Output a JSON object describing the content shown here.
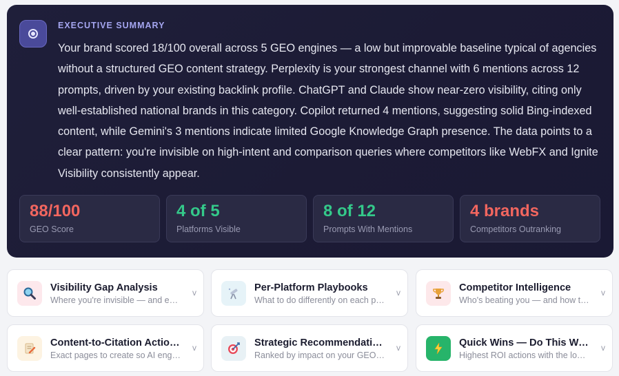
{
  "summary": {
    "eyebrow": "EXECUTIVE SUMMARY",
    "text": "Your brand scored 18/100 overall across 5 GEO engines — a low but improvable baseline typical of agencies without a structured GEO content strategy. Perplexity is your strongest channel with 6 mentions across 12 prompts, driven by your existing backlink profile. ChatGPT and Claude show near-zero visibility, citing only well-established national brands in this category. Copilot returned 4 mentions, suggesting solid Bing-indexed content, while Gemini's 3 mentions indicate limited Google Knowledge Graph presence. The data points to a clear pattern: you're invisible on high-intent and comparison queries where competitors like WebFX and Ignite Visibility consistently appear.",
    "icon": "target-icon"
  },
  "stats": [
    {
      "value": "88/100",
      "label": "GEO Score",
      "color": "#f2665f"
    },
    {
      "value": "4 of 5",
      "label": "Platforms Visible",
      "color": "#34c98a"
    },
    {
      "value": "8 of 12",
      "label": "Prompts With Mentions",
      "color": "#34c98a"
    },
    {
      "value": "4 brands",
      "label": "Competitors Outranking",
      "color": "#f2665f"
    }
  ],
  "cards": [
    {
      "title": "Visibility Gap Analysis",
      "subtitle": "Where you're invisible — and exactly why",
      "icon": "magnifier-icon",
      "chevron": "v"
    },
    {
      "title": "Per-Platform Playbooks",
      "subtitle": "What to do differently on each platform",
      "icon": "telescope-icon",
      "chevron": "v"
    },
    {
      "title": "Competitor Intelligence",
      "subtitle": "Who's beating you — and how they do it",
      "icon": "trophy-icon",
      "chevron": "v"
    },
    {
      "title": "Content-to-Citation Action Plan",
      "subtitle": "Exact pages to create so AI engines cite you",
      "icon": "memo-icon",
      "chevron": "v"
    },
    {
      "title": "Strategic Recommendations",
      "subtitle": "Ranked by impact on your GEO score",
      "icon": "dart-icon",
      "chevron": "v"
    },
    {
      "title": "Quick Wins — Do This Week",
      "subtitle": "Highest ROI actions with the lowest effort",
      "icon": "lightning-icon",
      "chevron": "v"
    }
  ]
}
